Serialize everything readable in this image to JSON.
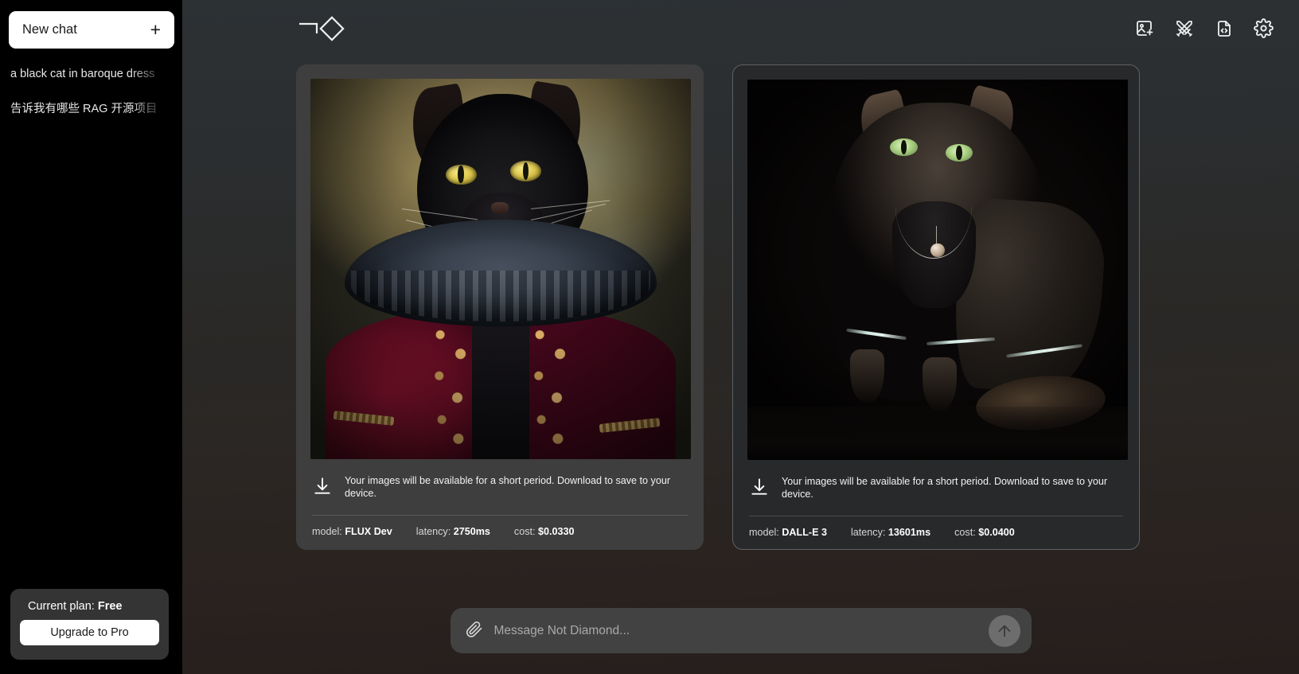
{
  "sidebar": {
    "new_chat_label": "New chat",
    "new_chat_icon": "plus-icon",
    "chats": [
      {
        "title": "a black cat in baroque dress"
      },
      {
        "title": "告诉我有哪些 RAG 开源项目"
      }
    ],
    "plan": {
      "label_prefix": "Current plan:",
      "label_value": "Free",
      "upgrade_label": "Upgrade to Pro"
    }
  },
  "header": {
    "brand_name": "Not Diamond",
    "brand_icons": [
      "corner-bracket-icon",
      "diamond-icon"
    ],
    "actions": [
      {
        "name": "image-plus-icon",
        "tooltip": "Image"
      },
      {
        "name": "crossed-swords-icon",
        "tooltip": "Arena"
      },
      {
        "name": "file-code-icon",
        "tooltip": "Code"
      },
      {
        "name": "gear-icon",
        "tooltip": "Settings"
      }
    ]
  },
  "results": {
    "download_notice": "Your images will be available for a short period. Download to save to your device.",
    "download_icon": "download-icon",
    "cards": [
      {
        "image_alt": "a black cat in baroque dress wearing a dark ruff collar and crimson doublet with gold scrollwork",
        "meta": {
          "model_key": "model:",
          "model_value": "FLUX Dev",
          "latency_key": "latency:",
          "latency_value": "2750ms",
          "cost_key": "cost:",
          "cost_value": "$0.0330"
        }
      },
      {
        "image_alt": "a dark cat in baroque dress with pearl necklace on a black background",
        "meta": {
          "model_key": "model:",
          "model_value": "DALL-E 3",
          "latency_key": "latency:",
          "latency_value": "13601ms",
          "cost_key": "cost:",
          "cost_value": "$0.0400"
        }
      }
    ]
  },
  "composer": {
    "attach_icon": "paperclip-icon",
    "placeholder": "Message Not Diamond...",
    "value": "",
    "send_icon": "arrow-up-icon"
  },
  "colors": {
    "sidebar_bg": "#000000",
    "accent_white": "#ffffff",
    "card_flux_bg": "#3e3e3e",
    "card_dalle_bg": "#27292b",
    "composer_bg": "#424242"
  }
}
